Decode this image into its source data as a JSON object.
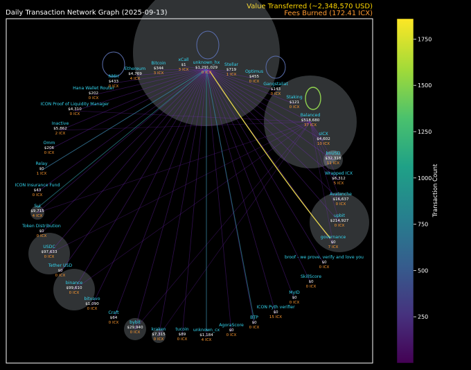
{
  "title": "Daily Transaction Network Graph (2025-09-13)",
  "value_transferred": "Value Transferred (~2,348,570 USD)",
  "fees_burned": "Fees Burned (172.41 ICX)",
  "colors": {
    "background": "#000000",
    "frame": "#ffffff",
    "node_name": "#33d6f0",
    "fee": "#ff9a30",
    "value": "#ffd700",
    "edge": "#8a2be2",
    "bubble": "#dce6f0"
  },
  "chart_data": {
    "type": "network",
    "colorbar": {
      "label": "Transaction Count",
      "ticks": [
        "250",
        "500",
        "750",
        "1000",
        "1250",
        "1500",
        "1750"
      ],
      "tick_values": [
        250,
        500,
        750,
        1000,
        1250,
        1500,
        1750
      ],
      "range": [
        0,
        1860
      ],
      "colormap": "viridis"
    },
    "nodes": [
      {
        "name": "Ethereum",
        "value": "$4,769",
        "fees": "4 ICX",
        "bubble": 0
      },
      {
        "name": "Bitcoin",
        "value": "$344",
        "fees": "3 ICX",
        "bubble": 0
      },
      {
        "name": "xCall",
        "value": "$1",
        "fees": "3 ICX",
        "bubble": 0
      },
      {
        "name": "unknown_hx",
        "value": "$1,291,029",
        "fees": "0 ICX",
        "bubble": 1,
        "self_loop": true
      },
      {
        "name": "Stellar",
        "value": "$719",
        "fees": "1 ICX",
        "bubble": 0
      },
      {
        "name": "Optimus",
        "value": "$455",
        "fees": "0 ICX",
        "bubble": 0,
        "self_loop": true
      },
      {
        "name": "Gangstaliat",
        "value": "$143",
        "fees": "0 ICX",
        "bubble": 0
      },
      {
        "name": "Staking",
        "value": "$121",
        "fees": "0 ICX",
        "bubble": 0,
        "self_loop": true
      },
      {
        "name": "Balanced",
        "value": "$518,680",
        "fees": "37 ICX",
        "bubble": 1
      },
      {
        "name": "sICX",
        "value": "$4,602",
        "fees": "10 ICX",
        "bubble": 0
      },
      {
        "name": "bnUSD",
        "value": "$32,318",
        "fees": "11 ICX",
        "bubble": 1
      },
      {
        "name": "Wrapped ICX",
        "value": "$6,312",
        "fees": "5 ICX",
        "bubble": 0
      },
      {
        "name": "Avalanche",
        "value": "$16,637",
        "fees": "0 ICX",
        "bubble": 0
      },
      {
        "name": "upbit",
        "value": "$214,927",
        "fees": "0 ICX",
        "bubble": 1
      },
      {
        "name": "governance",
        "value": "$0",
        "fees": "7 ICX",
        "bubble": 0
      },
      {
        "name": "broof - we prove, verify and love you",
        "value": "$0",
        "fees": "0 ICX",
        "bubble": 0
      },
      {
        "name": "SkillScore",
        "value": "$0",
        "fees": "0 ICX",
        "bubble": 0
      },
      {
        "name": "MyID",
        "value": "$0",
        "fees": "0 ICX",
        "bubble": 0
      },
      {
        "name": "ICON Pyth verifier",
        "value": "$0",
        "fees": "15 ICX",
        "bubble": 0
      },
      {
        "name": "BTP",
        "value": "$0",
        "fees": "0 ICX",
        "bubble": 0
      },
      {
        "name": "AgoraScore",
        "value": "$0",
        "fees": "0 ICX",
        "bubble": 0
      },
      {
        "name": "unknown_cx",
        "value": "$1,184",
        "fees": "4 ICX",
        "bubble": 0
      },
      {
        "name": "tucoin",
        "value": "$89",
        "fees": "0 ICX",
        "bubble": 0
      },
      {
        "name": "kraken",
        "value": "$7,315",
        "fees": "0 ICX",
        "bubble": 1
      },
      {
        "name": "bybit",
        "value": "$29,940",
        "fees": "0 ICX",
        "bubble": 1
      },
      {
        "name": "Craft",
        "value": "$64",
        "fees": "0 ICX",
        "bubble": 0
      },
      {
        "name": "bitvavo",
        "value": "$1,090",
        "fees": "0 ICX",
        "bubble": 0
      },
      {
        "name": "binance",
        "value": "$99,610",
        "fees": "0 ICX",
        "bubble": 1
      },
      {
        "name": "Tether USD",
        "value": "$0",
        "fees": "0 ICX",
        "bubble": 0
      },
      {
        "name": "USDC",
        "value": "$97,633",
        "fees": "0 ICX",
        "bubble": 1
      },
      {
        "name": "Token Distribution",
        "value": "$0",
        "fees": "0 ICX",
        "bubble": 0
      },
      {
        "name": "Sui",
        "value": "$9,715",
        "fees": "4 ICX",
        "bubble": 1
      },
      {
        "name": "ICON Insurance Fund",
        "value": "$43",
        "fees": "0 ICX",
        "bubble": 0
      },
      {
        "name": "Relay",
        "value": "$0",
        "fees": "1 ICX",
        "bubble": 0
      },
      {
        "name": "Omm",
        "value": "$206",
        "fees": "0 ICX",
        "bubble": 0
      },
      {
        "name": "Inactive",
        "value": "$5,862",
        "fees": "2 ICX",
        "bubble": 0
      },
      {
        "name": "ICON Proof of Liquidity Manager",
        "value": "$4,310",
        "fees": "0 ICX",
        "bubble": 0
      },
      {
        "name": "Hana Wallet Router",
        "value": "$202",
        "fees": "0 ICX",
        "bubble": 0
      },
      {
        "name": "NMH",
        "value": "$433",
        "fees": "0 ICX",
        "bubble": 0,
        "self_loop": true
      }
    ],
    "highlighted_edge": {
      "from": "unknown_hx",
      "to": "governance",
      "count": 1800
    }
  }
}
